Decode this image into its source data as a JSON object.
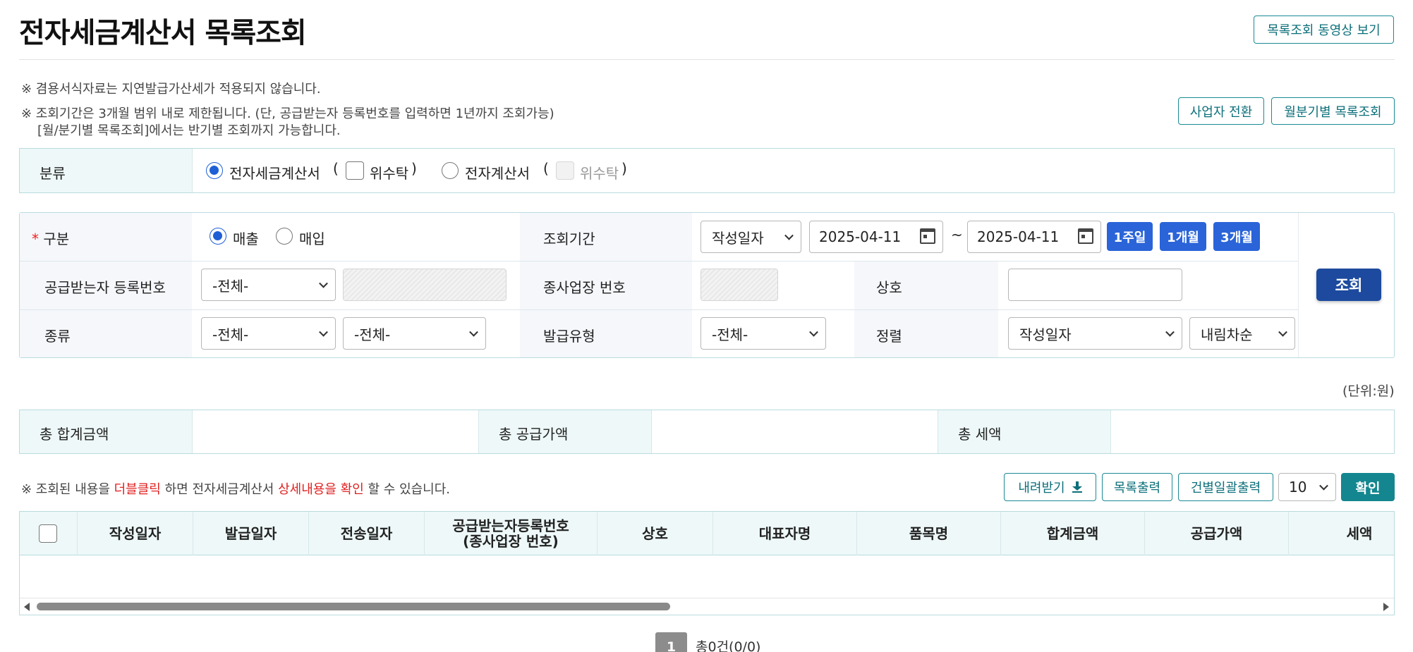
{
  "header": {
    "title": "전자세금계산서 목록조회",
    "video_button": "목록조회 동영상 보기"
  },
  "notices": {
    "line1": "※ 겸용서식자료는 지연발급가산세가 적용되지 않습니다.",
    "line2": "※ 조회기간은 3개월 범위 내로 제한됩니다. (단, 공급받는자 등록번호를 입력하면 1년까지 조회가능)",
    "line3": "[월/분기별 목록조회]에서는 반기별 조회까지 가능합니다."
  },
  "top_buttons": {
    "switch_business": "사업자 전환",
    "monthly_list": "월분기별 목록조회"
  },
  "category": {
    "label": "분류",
    "option1": "전자세금계산서",
    "option1_sub": "위수탁",
    "option2": "전자계산서",
    "option2_sub": "위수탁",
    "paren_open": "(",
    "paren_close": ")"
  },
  "search": {
    "required_mark": "*",
    "type_label": "구분",
    "sales": "매출",
    "purchase": "매입",
    "period_label": "조회기간",
    "period_basis": "작성일자",
    "date_from": "2025-04-11",
    "tilde": "~",
    "date_to": "2025-04-11",
    "btn_1week": "1주일",
    "btn_1month": "1개월",
    "btn_3month": "3개월",
    "recipient_label": "공급받는자 등록번호",
    "recipient_select": "-전체-",
    "branch_label": "종사업장 번호",
    "company_label": "상호",
    "kind_label": "종류",
    "kind_select1": "-전체-",
    "kind_select2": "-전체-",
    "issue_type_label": "발급유형",
    "issue_type_select": "-전체-",
    "sort_label": "정렬",
    "sort_select": "작성일자",
    "order_select": "내림차순",
    "search_button": "조회"
  },
  "totals": {
    "unit": "(단위:원)",
    "total_amount_label": "총 합계금액",
    "total_supply_label": "총 공급가액",
    "total_tax_label": "총 세액"
  },
  "list": {
    "notice_prefix": "※ 조회된 내용을",
    "notice_red1": "더블클릭",
    "notice_mid": "하면 전자세금계산서",
    "notice_red2": "상세내용을 확인",
    "notice_suffix": "할 수 있습니다.",
    "download": "내려받기",
    "print_list": "목록출력",
    "print_each": "건별일괄출력",
    "page_size": "10",
    "confirm": "확인",
    "columns": [
      "작성일자",
      "발급일자",
      "전송일자",
      "공급받는자등록번호\n(종사업장 번호)",
      "상호",
      "대표자명",
      "품목명",
      "합계금액",
      "공급가액",
      "세액"
    ]
  },
  "pagination": {
    "current_page": "1",
    "summary": "총0건(0/0)"
  }
}
